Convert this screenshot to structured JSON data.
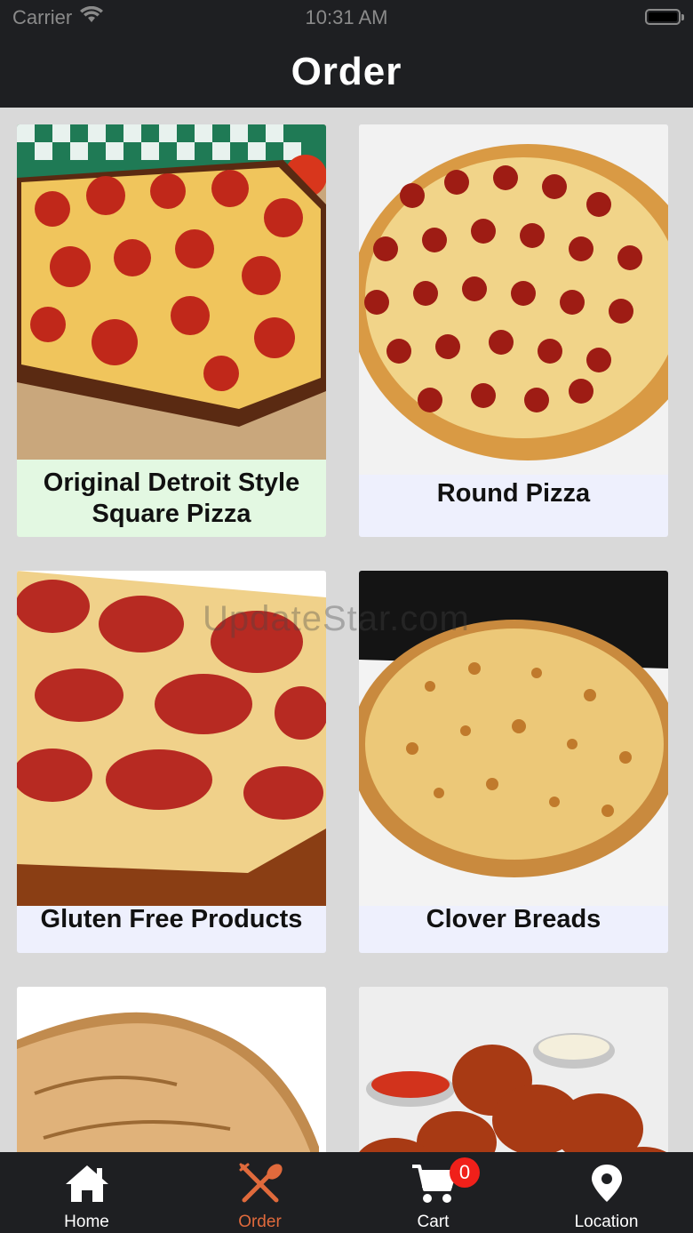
{
  "status_bar": {
    "carrier": "Carrier",
    "time": "10:31 AM"
  },
  "header": {
    "title": "Order"
  },
  "categories": [
    {
      "name": "Original Detroit Style Square Pizza"
    },
    {
      "name": "Round Pizza"
    },
    {
      "name": "Gluten Free Products"
    },
    {
      "name": "Clover Breads"
    },
    {
      "name": ""
    },
    {
      "name": ""
    }
  ],
  "watermark": "UpdateStar.com",
  "tab_bar": {
    "active": "Order",
    "tabs": [
      {
        "label": "Home",
        "icon": "home-icon"
      },
      {
        "label": "Order",
        "icon": "fork-knife-icon"
      },
      {
        "label": "Cart",
        "icon": "cart-icon",
        "badge": "0"
      },
      {
        "label": "Location",
        "icon": "location-pin-icon"
      }
    ]
  },
  "colors": {
    "bar_bg": "#1e1f22",
    "active_tab": "#e06a3c",
    "badge": "#f0201a",
    "card_bg": "#eef0fd",
    "featured_card_bg": "#e3f8e2"
  }
}
